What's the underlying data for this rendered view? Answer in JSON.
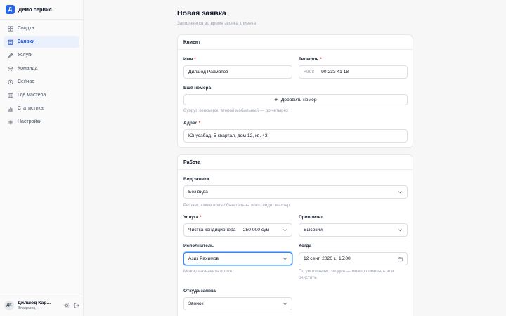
{
  "app": {
    "logo_letter": "Д",
    "name": "Демо сервис"
  },
  "sidebar": {
    "items": [
      {
        "label": "Сводка",
        "icon": "grid-icon",
        "active": false
      },
      {
        "label": "Заявки",
        "icon": "clipboard-icon",
        "active": true
      },
      {
        "label": "Услуги",
        "icon": "wrench-icon",
        "active": false
      },
      {
        "label": "Команда",
        "icon": "users-icon",
        "active": false
      },
      {
        "label": "Сейчас",
        "icon": "activity-icon",
        "active": false
      },
      {
        "label": "Где мастера",
        "icon": "map-icon",
        "active": false
      },
      {
        "label": "Статистика",
        "icon": "bar-chart-icon",
        "active": false
      },
      {
        "label": "Настройки",
        "icon": "gear-icon",
        "active": false
      }
    ]
  },
  "user": {
    "initials": "ДК",
    "name": "Дилшод Кар...",
    "role": "Владелец"
  },
  "page": {
    "title": "Новая заявка",
    "subtitle": "Заполняется во время звонка клиента"
  },
  "client": {
    "title": "Клиент",
    "name_label": "Имя",
    "name_value": "Дилшод Рахматов",
    "phone_label": "Телефон",
    "phone_prefix": "+998",
    "phone_value": "90 233 41 18",
    "extra_label": "Ещё номера",
    "add_number": "Добавить номер",
    "extra_hint": "Супруг, консьерж, второй мобильный — до четырёх",
    "address_label": "Адрес",
    "address_value": "Юнусабад, 5-квартал, дом 12, кв. 43"
  },
  "work": {
    "title": "Работа",
    "type_label": "Вид заявки",
    "type_value": "Без вида",
    "type_hint": "Решает, какие поля обязательны и что видит мастер",
    "service_label": "Услуга",
    "service_value": "Чистка кондиционера — 250 000 сум",
    "priority_label": "Приоритет",
    "priority_value": "Высокий",
    "assignee_label": "Исполнитель",
    "assignee_value": "Азиз Рахимов",
    "assignee_hint": "Можно назначить позже",
    "when_label": "Когда",
    "when_value": "12 сент. 2026 г., 15:00",
    "when_hint": "По умолчанию сегодня — можно поменять или очистить",
    "source_label": "Откуда заявка",
    "source_value": "Звонок"
  },
  "colors": {
    "accent": "#2563eb",
    "required": "#dc2626",
    "active_bg": "#eaf1fd"
  }
}
